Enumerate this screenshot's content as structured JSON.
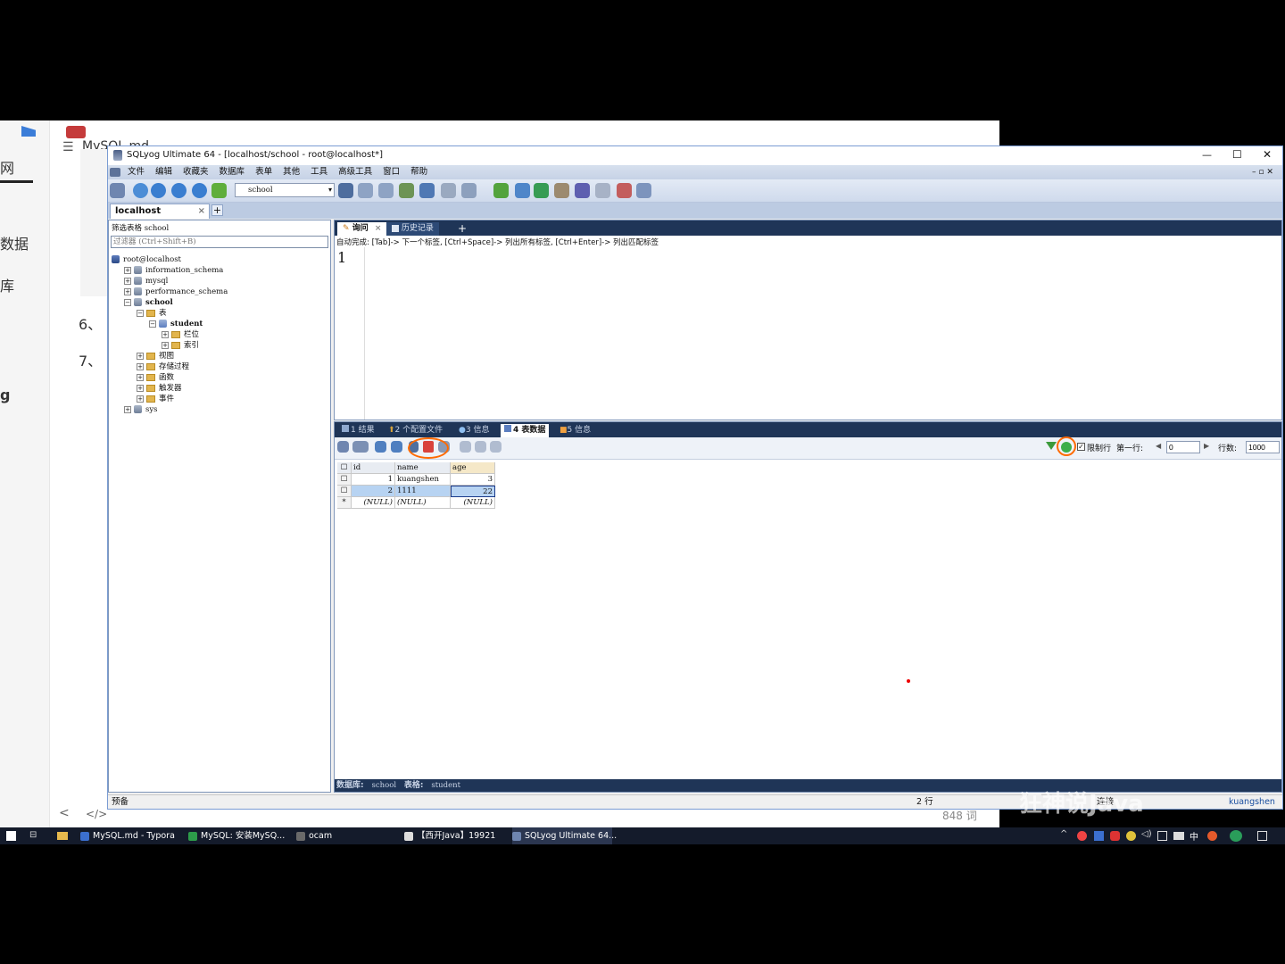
{
  "typora": {
    "doc_title": "MySQL.md",
    "side_text": [
      "网",
      "数据",
      "库",
      "g"
    ],
    "list_items": [
      "6、",
      "7、"
    ],
    "word_count": "848 词",
    "nav_prev": "<",
    "nav_source": "</>"
  },
  "window": {
    "title": "SQLyog Ultimate 64 - [localhost/school - root@localhost*]",
    "controls": {
      "minimize": "—",
      "maximize": "☐",
      "close": "✕"
    }
  },
  "menu": [
    "文件",
    "编辑",
    "收藏夹",
    "数据库",
    "表单",
    "其他",
    "工具",
    "高级工具",
    "窗口",
    "帮助"
  ],
  "toolbar": {
    "db_select": "school"
  },
  "connection_tab": {
    "label": "localhost",
    "close": "×",
    "add": "+"
  },
  "tree": {
    "filter_label": "筛选表格 school",
    "filter_placeholder": "过滤器 (Ctrl+Shift+B)",
    "root": "root@localhost",
    "items": [
      {
        "label": "information_schema",
        "level": 1,
        "kind": "db"
      },
      {
        "label": "mysql",
        "level": 1,
        "kind": "db"
      },
      {
        "label": "performance_schema",
        "level": 1,
        "kind": "db"
      },
      {
        "label": "school",
        "level": 1,
        "kind": "db"
      },
      {
        "label": "表",
        "level": 2,
        "kind": "folder"
      },
      {
        "label": "student",
        "level": 3,
        "kind": "table"
      },
      {
        "label": "栏位",
        "level": 4,
        "kind": "folder"
      },
      {
        "label": "索引",
        "level": 4,
        "kind": "folder"
      },
      {
        "label": "视图",
        "level": 2,
        "kind": "folder"
      },
      {
        "label": "存储过程",
        "level": 2,
        "kind": "folder"
      },
      {
        "label": "函数",
        "level": 2,
        "kind": "folder"
      },
      {
        "label": "触发器",
        "level": 2,
        "kind": "folder"
      },
      {
        "label": "事件",
        "level": 2,
        "kind": "folder"
      },
      {
        "label": "sys",
        "level": 1,
        "kind": "db"
      }
    ]
  },
  "editor": {
    "tabs": [
      {
        "label": "询问",
        "close": "×"
      },
      {
        "label": "历史记录"
      }
    ],
    "add_tab": "+",
    "hint": "自动完成: [Tab]-> 下一个标签, [Ctrl+Space]-> 列出所有标签, [Ctrl+Enter]-> 列出匹配标签",
    "line_number": "1"
  },
  "results": {
    "tabs": [
      "1 结果",
      "2 个配置文件",
      "3 信息",
      "4 表数据",
      "5 信息"
    ],
    "active_tab": "4 表数据",
    "limit_label": "限制行",
    "first_row_label": "第一行:",
    "first_row_value": "0",
    "rows_label": "行数:",
    "rows_value": "1000",
    "columns": [
      "id",
      "name",
      "age"
    ],
    "rows": [
      [
        "1",
        "kuangshen",
        "3"
      ],
      [
        "2",
        "1111",
        "22"
      ],
      [
        "(NULL)",
        "(NULL)",
        "(NULL)"
      ]
    ],
    "new_row_marker": "*",
    "status_db_label": "数据库:",
    "status_db": "school",
    "status_table_label": "表格:",
    "status_table": "student"
  },
  "statusbar": {
    "left": "预备",
    "rows": "2 行",
    "connection": "连接",
    "user": "kuangshen"
  },
  "watermark": "狂神说Java",
  "taskbar": {
    "items": [
      "MySQL.md - Typora",
      "MySQL: 安装MySQ...",
      "ocam",
      "【西开Java】19921",
      "SQLyog Ultimate 64..."
    ],
    "tray_lang": "中"
  },
  "colors": {
    "accent_circle": "#ff6a00",
    "panel_dark": "#1f3557",
    "selection": "#b7d3f2"
  }
}
